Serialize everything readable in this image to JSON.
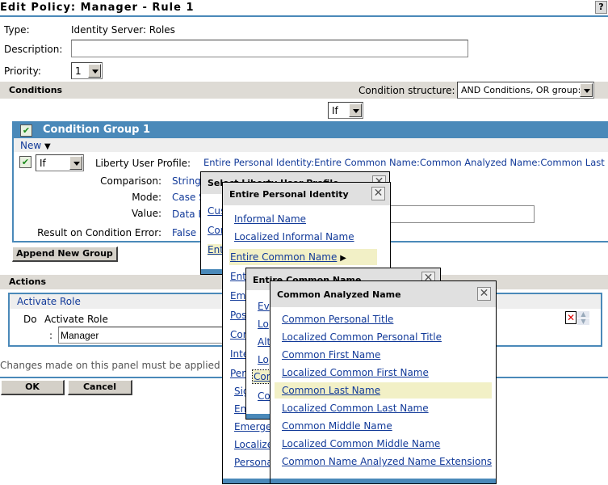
{
  "title": "Edit Policy: Manager - Rule 1",
  "help": "?",
  "form": {
    "type_label": "Type:",
    "type_value": "Identity Server: Roles",
    "description_label": "Description:",
    "description_value": "",
    "priority_label": "Priority:",
    "priority_value": "1"
  },
  "conditions": {
    "heading": "Conditions",
    "structure_label": "Condition structure:",
    "structure_value": "AND Conditions, OR group:",
    "group_operator": "If",
    "group": {
      "title": "Condition Group 1",
      "new_label": "New",
      "row_operator": "If",
      "profile_label": "Liberty User Profile:",
      "profile_value": "Entire Personal Identity:Entire Common Name:Common Analyzed Name:Common Last Name",
      "comparison_label": "Comparison:",
      "comparison_value": "String",
      "mode_label": "Mode:",
      "mode_value": "Case S",
      "value_label": "Value:",
      "value_value": "Data E",
      "error_label": "Result on Condition Error:",
      "error_value": "False"
    },
    "append_label": "Append New Group"
  },
  "actions": {
    "heading": "Actions",
    "header_link": "Activate Role",
    "do_label": "Do",
    "action": "Activate Role",
    "colon": ":",
    "role_value": "Manager"
  },
  "notice": "Changes made on this panel must be applied from",
  "buttons": {
    "ok": "OK",
    "cancel": "Cancel"
  },
  "popups": {
    "select_profile": {
      "title": "Select Liberty User Profile",
      "items": [
        "Cus",
        "Con",
        "Ent"
      ]
    },
    "personal_identity": {
      "title": "Entire Personal Identity",
      "items": [
        "Informal Name",
        "Localized Informal Name",
        "Entire Common Name",
        "Ent",
        "Emp",
        "Pos",
        "Con",
        "Inte",
        "Per",
        "Sig",
        "En",
        "Emerge",
        "Localize",
        "Persona"
      ]
    },
    "common_name": {
      "title": "Entire Common Name",
      "items": [
        "Ev",
        "Lo",
        "Alt",
        "Lo",
        "Com",
        "Co"
      ]
    },
    "analyzed_name": {
      "title": "Common Analyzed Name",
      "items": [
        "Common Personal Title",
        "Localized Common Personal Title",
        "Common First Name",
        "Localized Common First Name",
        "Common Last Name",
        "Localized Common Last Name",
        "Common Middle Name",
        "Localized Common Middle Name",
        "Common Name Analyzed Name Extensions"
      ]
    }
  }
}
